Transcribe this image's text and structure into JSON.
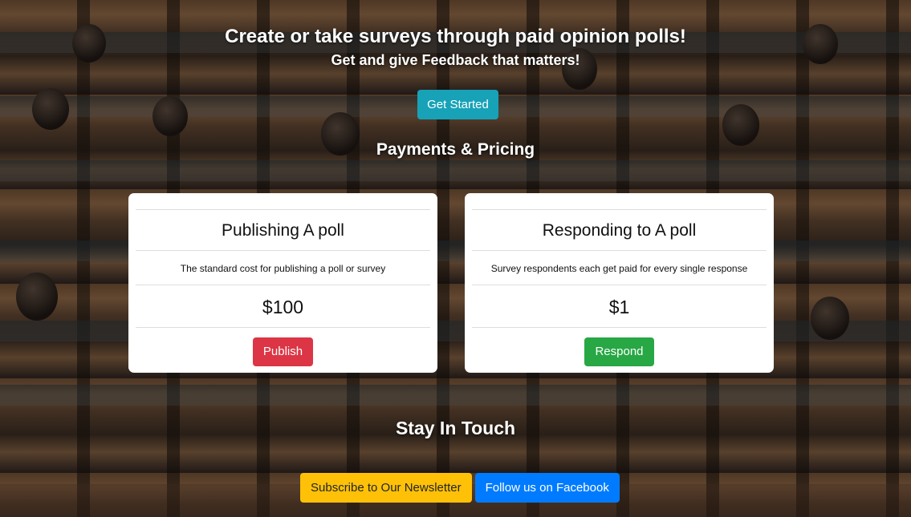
{
  "hero": {
    "title": "Create or take surveys through paid opinion polls!",
    "subtitle": "Get and give Feedback that matters!",
    "cta_label": "Get Started"
  },
  "pricing": {
    "section_title": "Payments & Pricing",
    "cards": [
      {
        "title": "Publishing A poll",
        "description": "The standard cost for publishing a poll or survey",
        "price": "$100",
        "button_label": "Publish",
        "button_color": "#dc3545"
      },
      {
        "title": "Responding to A poll",
        "description": "Survey respondents each get paid for every single response",
        "price": "$1",
        "button_label": "Respond",
        "button_color": "#28a745"
      }
    ]
  },
  "contact": {
    "section_title": "Stay In Touch",
    "newsletter_label": "Subscribe to Our Newsletter",
    "facebook_label": "Follow us on Facebook"
  },
  "colors": {
    "accent": "#17a2b8",
    "danger": "#dc3545",
    "success": "#28a745",
    "warning": "#ffc107",
    "primary": "#007bff"
  }
}
